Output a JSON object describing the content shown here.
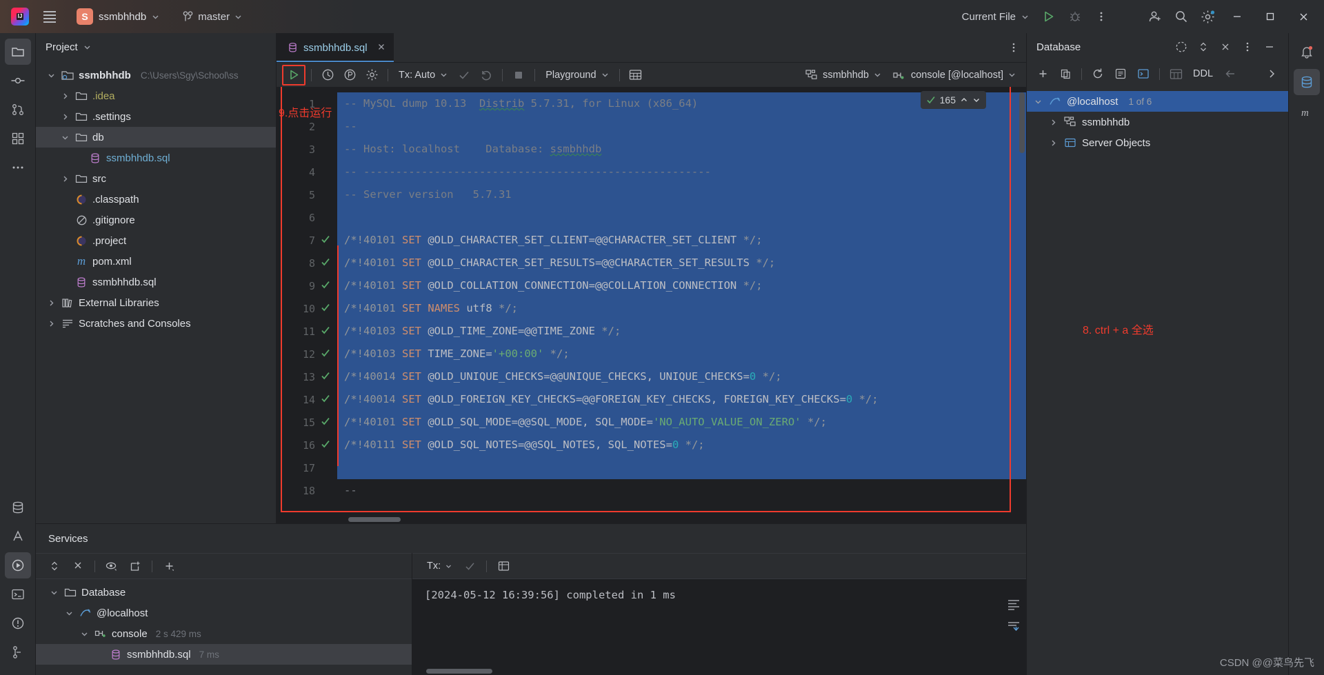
{
  "titlebar": {
    "logo_label": "IJ",
    "project_badge": "S",
    "project_name": "ssmbhhdb",
    "branch": "master",
    "run_config": "Current File",
    "icons": {
      "menu": "hamburger-menu-icon",
      "run": "run-icon",
      "debug": "debug-icon",
      "more": "more-vertical-icon",
      "account": "account-icon",
      "search": "search-icon",
      "settings": "settings-icon",
      "minimize": "minimize-icon",
      "maximize": "maximize-icon",
      "close": "close-icon"
    }
  },
  "project_panel": {
    "title": "Project",
    "tree": [
      {
        "label": "ssmbhhdb",
        "path": "C:\\Users\\Sgy\\School\\ss",
        "indent": 0,
        "arrow": "down",
        "icon": "project-folder-icon",
        "bold": true,
        "selected": false
      },
      {
        "label": ".idea",
        "path": "",
        "indent": 1,
        "arrow": "right",
        "icon": "folder-icon",
        "color": "yellow",
        "selected": false
      },
      {
        "label": ".settings",
        "path": "",
        "indent": 1,
        "arrow": "right",
        "icon": "folder-icon",
        "selected": false
      },
      {
        "label": "db",
        "path": "",
        "indent": 1,
        "arrow": "down",
        "icon": "folder-icon",
        "selected": true
      },
      {
        "label": "ssmbhhdb.sql",
        "path": "",
        "indent": 2,
        "arrow": "none",
        "icon": "database-file-icon",
        "color": "blue",
        "selected": false
      },
      {
        "label": "src",
        "path": "",
        "indent": 1,
        "arrow": "right",
        "icon": "folder-icon",
        "selected": false
      },
      {
        "label": ".classpath",
        "path": "",
        "indent": 1,
        "arrow": "none",
        "icon": "eclipse-file-icon",
        "selected": false
      },
      {
        "label": ".gitignore",
        "path": "",
        "indent": 1,
        "arrow": "none",
        "icon": "gitignore-icon",
        "selected": false
      },
      {
        "label": ".project",
        "path": "",
        "indent": 1,
        "arrow": "none",
        "icon": "eclipse-file-icon",
        "selected": false
      },
      {
        "label": "pom.xml",
        "path": "",
        "indent": 1,
        "arrow": "none",
        "icon": "maven-icon",
        "selected": false
      },
      {
        "label": "ssmbhhdb.sql",
        "path": "",
        "indent": 1,
        "arrow": "none",
        "icon": "database-file-icon",
        "selected": false
      },
      {
        "label": "External Libraries",
        "path": "",
        "indent": 0,
        "arrow": "right",
        "icon": "libraries-icon",
        "selected": false
      },
      {
        "label": "Scratches and Consoles",
        "path": "",
        "indent": 0,
        "arrow": "right",
        "icon": "scratches-icon",
        "selected": false
      }
    ]
  },
  "editor": {
    "tab_label": "ssmbhhdb.sql",
    "toolbar": {
      "run_label": "run-query-button",
      "history_label": "history-icon",
      "explain_label": "explain-plan-icon",
      "settings_label": "data-source-settings-icon",
      "tx_label": "Tx: Auto",
      "commit_label": "commit-icon",
      "rollback_label": "rollback-icon",
      "stop_label": "stop-icon",
      "schema_label": "Playground",
      "grid_label": "toggle-grid-icon",
      "datasource_label": "ssmbhhdb",
      "session_label": "console [@localhost]"
    },
    "inspection_count": "165",
    "annotations": [
      {
        "id": "run-annotation",
        "text": "9.点击运行"
      },
      {
        "id": "select-all-annotation",
        "text": "8. ctrl + a 全选"
      }
    ],
    "lines": [
      {
        "num": "1",
        "check": false,
        "selected": true,
        "tokens": [
          {
            "t": "-- MySQL dump 10.13  ",
            "c": "cmt"
          },
          {
            "t": "Distrib",
            "c": "cmt squig"
          },
          {
            "t": " 5.7.31, for Linux (x86_64)",
            "c": "cmt"
          }
        ]
      },
      {
        "num": "2",
        "check": false,
        "selected": true,
        "tokens": [
          {
            "t": "--",
            "c": "cmt"
          }
        ]
      },
      {
        "num": "3",
        "check": false,
        "selected": true,
        "tokens": [
          {
            "t": "-- Host: localhost    Database: ",
            "c": "cmt"
          },
          {
            "t": "ssmbhhdb",
            "c": "cmt squig"
          }
        ]
      },
      {
        "num": "4",
        "check": false,
        "selected": true,
        "tokens": [
          {
            "t": "-- ------------------------------------------------------",
            "c": "cmt"
          }
        ]
      },
      {
        "num": "5",
        "check": false,
        "selected": true,
        "tokens": [
          {
            "t": "-- Server version   5.7.31",
            "c": "cmt"
          }
        ]
      },
      {
        "num": "6",
        "check": false,
        "selected": true,
        "tokens": [
          {
            "t": "",
            "c": "cmt"
          }
        ]
      },
      {
        "num": "7",
        "check": true,
        "selected": true,
        "tokens": [
          {
            "t": "/*!40101 ",
            "c": "sqlcmt"
          },
          {
            "t": "SET",
            "c": "kw"
          },
          {
            "t": " @OLD_CHARACTER_SET_CLIENT=@@CHARACTER_SET_CLIENT ",
            "c": "plain"
          },
          {
            "t": "*/;",
            "c": "sqlcmt"
          }
        ]
      },
      {
        "num": "8",
        "check": true,
        "selected": true,
        "tokens": [
          {
            "t": "/*!40101 ",
            "c": "sqlcmt"
          },
          {
            "t": "SET",
            "c": "kw"
          },
          {
            "t": " @OLD_CHARACTER_SET_RESULTS=@@CHARACTER_SET_RESULTS ",
            "c": "plain"
          },
          {
            "t": "*/;",
            "c": "sqlcmt"
          }
        ]
      },
      {
        "num": "9",
        "check": true,
        "selected": true,
        "tokens": [
          {
            "t": "/*!40101 ",
            "c": "sqlcmt"
          },
          {
            "t": "SET",
            "c": "kw"
          },
          {
            "t": " @OLD_COLLATION_CONNECTION=@@COLLATION_CONNECTION ",
            "c": "plain"
          },
          {
            "t": "*/;",
            "c": "sqlcmt"
          }
        ]
      },
      {
        "num": "10",
        "check": true,
        "selected": true,
        "tokens": [
          {
            "t": "/*!40101 ",
            "c": "sqlcmt"
          },
          {
            "t": "SET",
            "c": "kw"
          },
          {
            "t": " ",
            "c": "plain"
          },
          {
            "t": "NAMES",
            "c": "kw"
          },
          {
            "t": " utf8 ",
            "c": "plain"
          },
          {
            "t": "*/;",
            "c": "sqlcmt"
          }
        ]
      },
      {
        "num": "11",
        "check": true,
        "selected": true,
        "tokens": [
          {
            "t": "/*!40103 ",
            "c": "sqlcmt"
          },
          {
            "t": "SET",
            "c": "kw"
          },
          {
            "t": " @OLD_TIME_ZONE=@@TIME_ZONE ",
            "c": "plain"
          },
          {
            "t": "*/;",
            "c": "sqlcmt"
          }
        ]
      },
      {
        "num": "12",
        "check": true,
        "selected": true,
        "tokens": [
          {
            "t": "/*!40103 ",
            "c": "sqlcmt"
          },
          {
            "t": "SET",
            "c": "kw"
          },
          {
            "t": " TIME_ZONE=",
            "c": "plain"
          },
          {
            "t": "'+00:00'",
            "c": "str"
          },
          {
            "t": " ",
            "c": "plain"
          },
          {
            "t": "*/;",
            "c": "sqlcmt"
          }
        ]
      },
      {
        "num": "13",
        "check": true,
        "selected": true,
        "tokens": [
          {
            "t": "/*!40014 ",
            "c": "sqlcmt"
          },
          {
            "t": "SET",
            "c": "kw"
          },
          {
            "t": " @OLD_UNIQUE_CHECKS=@@UNIQUE_CHECKS, UNIQUE_CHECKS=",
            "c": "plain"
          },
          {
            "t": "0",
            "c": "num"
          },
          {
            "t": " ",
            "c": "plain"
          },
          {
            "t": "*/;",
            "c": "sqlcmt"
          }
        ]
      },
      {
        "num": "14",
        "check": true,
        "selected": true,
        "tokens": [
          {
            "t": "/*!40014 ",
            "c": "sqlcmt"
          },
          {
            "t": "SET",
            "c": "kw"
          },
          {
            "t": " @OLD_FOREIGN_KEY_CHECKS=@@FOREIGN_KEY_CHECKS, FOREIGN_KEY_CHECKS=",
            "c": "plain"
          },
          {
            "t": "0",
            "c": "num"
          },
          {
            "t": " ",
            "c": "plain"
          },
          {
            "t": "*/;",
            "c": "sqlcmt"
          }
        ]
      },
      {
        "num": "15",
        "check": true,
        "selected": true,
        "tokens": [
          {
            "t": "/*!40101 ",
            "c": "sqlcmt"
          },
          {
            "t": "SET",
            "c": "kw"
          },
          {
            "t": " @OLD_SQL_MODE=@@SQL_MODE, SQL_MODE=",
            "c": "plain"
          },
          {
            "t": "'NO_AUTO_VALUE_ON_ZERO'",
            "c": "str"
          },
          {
            "t": " ",
            "c": "plain"
          },
          {
            "t": "*/;",
            "c": "sqlcmt"
          }
        ]
      },
      {
        "num": "16",
        "check": true,
        "selected": true,
        "tokens": [
          {
            "t": "/*!40111 ",
            "c": "sqlcmt"
          },
          {
            "t": "SET",
            "c": "kw"
          },
          {
            "t": " @OLD_SQL_NOTES=@@SQL_NOTES, SQL_NOTES=",
            "c": "plain"
          },
          {
            "t": "0",
            "c": "num"
          },
          {
            "t": " ",
            "c": "plain"
          },
          {
            "t": "*/;",
            "c": "sqlcmt"
          }
        ]
      },
      {
        "num": "17",
        "check": false,
        "selected": true,
        "tokens": [
          {
            "t": "",
            "c": "plain"
          }
        ]
      },
      {
        "num": "18",
        "check": false,
        "selected": false,
        "tokens": [
          {
            "t": "--",
            "c": "cmt"
          }
        ]
      }
    ]
  },
  "services": {
    "title": "Services",
    "toolbar_icons": [
      "expand-collapse-icon",
      "close-all-icon",
      "view-options-icon",
      "new-tab-icon",
      "add-icon"
    ],
    "tree": [
      {
        "label": "Database",
        "meta": "",
        "indent": 0,
        "arrow": "down",
        "icon": "folder-icon",
        "selected": false
      },
      {
        "label": "@localhost",
        "meta": "",
        "indent": 1,
        "arrow": "down",
        "icon": "mysql-icon",
        "selected": false
      },
      {
        "label": "console",
        "meta": "2 s 429 ms",
        "indent": 2,
        "arrow": "down",
        "icon": "console-icon",
        "selected": false
      },
      {
        "label": "ssmbhhdb.sql",
        "meta": "7 ms",
        "indent": 3,
        "arrow": "none",
        "icon": "database-file-icon",
        "selected": true
      }
    ],
    "output_toolbar": {
      "tx_label": "Tx:",
      "commit_label": "commit-icon",
      "grid_label": "grid-icon"
    },
    "output_line": "[2024-05-12 16:39:56] completed in 1 ms"
  },
  "database_panel": {
    "title": "Database",
    "header_icons": [
      "sync-icon",
      "collapse-icon",
      "close-panel-icon",
      "options-icon",
      "minimize-panel-icon"
    ],
    "toolbar": {
      "add_label": "add-data-source-icon",
      "duplicate_label": "duplicate-icon",
      "refresh_label": "refresh-icon",
      "properties_label": "properties-icon",
      "console_label": "open-console-icon",
      "table_label": "jump-to-table-icon",
      "ddl_label": "DDL",
      "back_label": "back-icon",
      "forward_label": "forward-icon"
    },
    "tree": [
      {
        "label": "@localhost",
        "meta": "1 of 6",
        "indent": 0,
        "arrow": "down",
        "icon": "mysql-icon",
        "selected": true
      },
      {
        "label": "ssmbhhdb",
        "meta": "",
        "indent": 1,
        "arrow": "right",
        "icon": "schema-icon",
        "selected": false
      },
      {
        "label": "Server Objects",
        "meta": "",
        "indent": 1,
        "arrow": "right",
        "icon": "server-objects-icon",
        "selected": false
      }
    ]
  },
  "left_rail": [
    {
      "name": "project-tool-icon",
      "active": true
    },
    {
      "name": "commit-tool-icon",
      "active": false
    },
    {
      "name": "pull-requests-tool-icon",
      "active": false
    },
    {
      "name": "structure-tool-icon",
      "active": false
    },
    {
      "name": "more-tools-icon",
      "active": false
    },
    {
      "name": "database-tool-icon",
      "active": false
    },
    {
      "name": "ai-assistant-icon",
      "active": false
    },
    {
      "name": "services-tool-icon",
      "active": true
    },
    {
      "name": "terminal-tool-icon",
      "active": false
    },
    {
      "name": "problems-tool-icon",
      "active": false
    },
    {
      "name": "version-control-tool-icon",
      "active": false
    }
  ],
  "right_rail": [
    {
      "name": "notifications-icon",
      "active": false
    },
    {
      "name": "database-tool-icon",
      "active": true
    },
    {
      "name": "maven-tool-icon",
      "active": false
    }
  ],
  "watermark": "CSDN @@菜鸟先飞",
  "colors": {
    "accent_red": "#ef3b2d",
    "selection_blue": "#2d5390",
    "tree_selection": "#2f5a9e",
    "run_green": "#59a869"
  }
}
